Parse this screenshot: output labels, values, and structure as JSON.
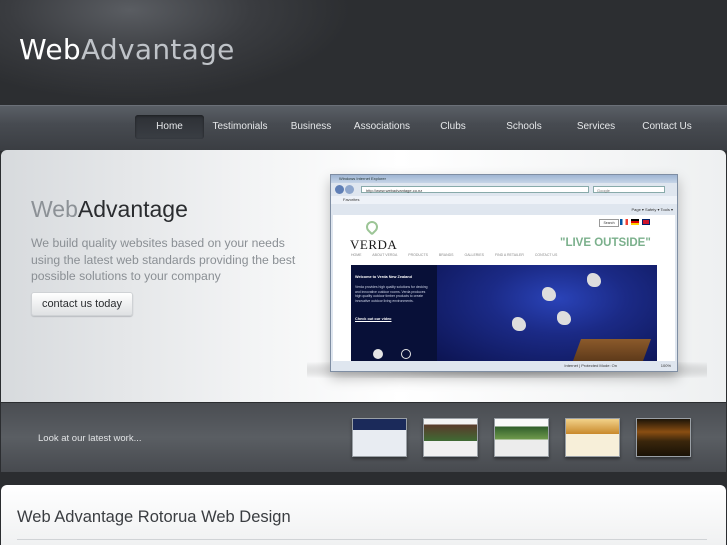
{
  "header": {
    "logo_web": "Web",
    "logo_advantage": "Advantage"
  },
  "nav": {
    "items": [
      "Home",
      "Testimonials",
      "Business",
      "Associations",
      "Clubs",
      "Schools",
      "Services",
      "Contact Us"
    ],
    "active": "Home"
  },
  "hero": {
    "title_web": "Web",
    "title_advantage": "Advantage",
    "description": "We build quality websites based on your needs using the latest web standards providing the best possible solutions to your company",
    "cta_label": "contact us today"
  },
  "browser_screenshot": {
    "window_title": "Windows Internet Explorer",
    "address": "http://www.webadvantage.co.nz",
    "search_placeholder": "Google",
    "favorites": "Favorites",
    "toolbar_items": "Page ▾  Safety ▾  Tools ▾",
    "status": "Internet | Protected Mode: On",
    "zoom": "100%",
    "site": {
      "logo": "VERDA",
      "search_button": "Search",
      "slogan": "\"LIVE OUTSIDE\"",
      "nav": [
        "HOME",
        "ABOUT VERDA",
        "PRODUCTS",
        "BRANDS",
        "GALLERIES",
        "FIND A RETAILER",
        "CONTACT US"
      ],
      "welcome": "Welcome to Verda New Zealand",
      "text": "Verda provides high quality solutions for decking and innovative outdoor rooms. Verda produces high quality outdoor timber products to create innovative outdoor living environments.",
      "video_link": "Check out our video"
    }
  },
  "work": {
    "label": "Look at our latest work..."
  },
  "footer": {
    "heading": "Web Advantage Rotorua Web Design"
  },
  "colors": {
    "background": "#2b2d30",
    "accent_green": "#7bb08c",
    "text_dark": "#2a2c2f"
  }
}
